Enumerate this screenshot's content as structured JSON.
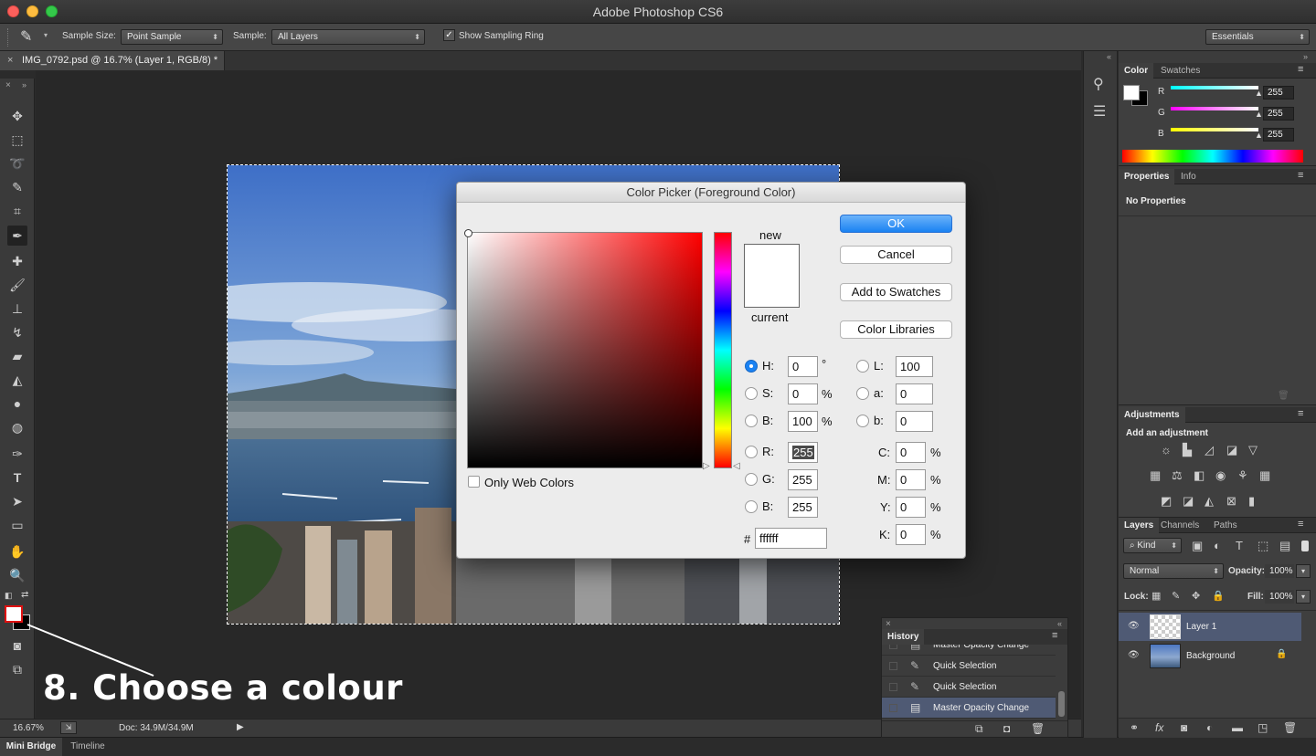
{
  "titlebar": {
    "title": "Adobe Photoshop CS6"
  },
  "options": {
    "sample_size_label": "Sample Size:",
    "sample_size_value": "Point Sample",
    "sample_label": "Sample:",
    "sample_value": "All Layers",
    "show_ring_label": "Show Sampling Ring",
    "show_ring_checked": true,
    "workspace_value": "Essentials"
  },
  "document_tab": {
    "label": "IMG_0792.psd @ 16.7% (Layer 1, RGB/8) *"
  },
  "annotation": {
    "text": "8. Choose a colour"
  },
  "status": {
    "zoom": "16.67%",
    "doc": "Doc: 34.9M/34.9M"
  },
  "bottom_tabs": [
    "Mini Bridge",
    "Timeline"
  ],
  "color_panel": {
    "tabs": [
      "Color",
      "Swatches"
    ],
    "channels": [
      {
        "label": "R",
        "value": "255"
      },
      {
        "label": "G",
        "value": "255"
      },
      {
        "label": "B",
        "value": "255"
      }
    ]
  },
  "properties_panel": {
    "tabs": [
      "Properties",
      "Info"
    ],
    "text": "No Properties"
  },
  "adjustments_panel": {
    "tab": "Adjustments",
    "text": "Add an adjustment"
  },
  "layers_panel": {
    "tabs": [
      "Layers",
      "Channels",
      "Paths"
    ],
    "kind_label": "Kind",
    "blend_mode": "Normal",
    "opacity_label": "Opacity:",
    "opacity_value": "100%",
    "lock_label": "Lock:",
    "fill_label": "Fill:",
    "fill_value": "100%",
    "layers": [
      {
        "name": "Layer 1",
        "selected": true
      },
      {
        "name": "Background",
        "selected": false
      }
    ]
  },
  "history_panel": {
    "tab": "History",
    "items": [
      "Master Opacity Change",
      "Quick Selection",
      "Quick Selection",
      "Master Opacity Change"
    ]
  },
  "dialog": {
    "title": "Color Picker (Foreground Color)",
    "ok": "OK",
    "cancel": "Cancel",
    "add_swatches": "Add to Swatches",
    "color_libraries": "Color Libraries",
    "new_label": "new",
    "current_label": "current",
    "only_web_colors": "Only Web Colors",
    "hsb": [
      {
        "label": "H:",
        "value": "0",
        "unit": "°"
      },
      {
        "label": "S:",
        "value": "0",
        "unit": "%"
      },
      {
        "label": "B:",
        "value": "100",
        "unit": "%"
      }
    ],
    "rgb": [
      {
        "label": "R:",
        "value": "255"
      },
      {
        "label": "G:",
        "value": "255"
      },
      {
        "label": "B:",
        "value": "255"
      }
    ],
    "lab": [
      {
        "label": "L:",
        "value": "100"
      },
      {
        "label": "a:",
        "value": "0"
      },
      {
        "label": "b:",
        "value": "0"
      }
    ],
    "cmyk": [
      {
        "label": "C:",
        "value": "0",
        "unit": "%"
      },
      {
        "label": "M:",
        "value": "0",
        "unit": "%"
      },
      {
        "label": "Y:",
        "value": "0",
        "unit": "%"
      },
      {
        "label": "K:",
        "value": "0",
        "unit": "%"
      }
    ],
    "hex_label": "#",
    "hex_value": "ffffff"
  },
  "colors": {
    "accent": "#1a82f2",
    "foreground": "#ffffff",
    "picker_hue": "#ff0000"
  }
}
